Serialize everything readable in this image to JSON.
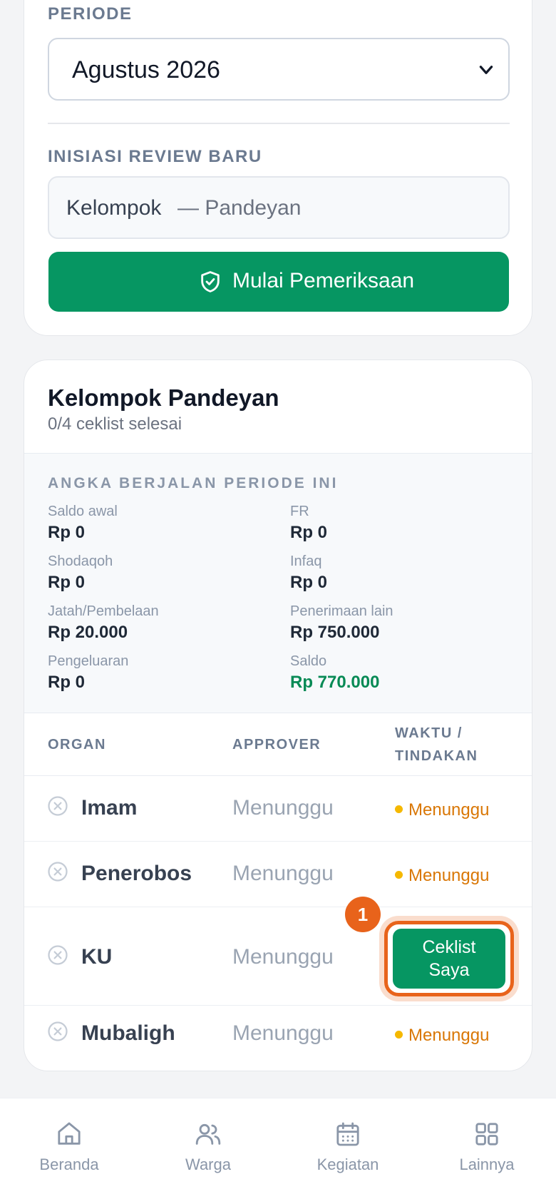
{
  "form": {
    "period_label": "PERIODE",
    "period_value": "Agustus 2026",
    "review_label": "INISIASI REVIEW BARU",
    "review_value": "Kelompok",
    "review_hint": "— Pandeyan",
    "start_button": "Mulai Pemeriksaan"
  },
  "group": {
    "title": "Kelompok Pandeyan",
    "subtitle": "0/4 ceklist selesai",
    "stats_heading": "ANGKA BERJALAN PERIODE INI",
    "stats": [
      {
        "label": "Saldo awal",
        "value": "Rp 0"
      },
      {
        "label": "FR",
        "value": "Rp 0"
      },
      {
        "label": "Shodaqoh",
        "value": "Rp 0"
      },
      {
        "label": "Infaq",
        "value": "Rp 0"
      },
      {
        "label": "Jatah/Pembelaan",
        "value": "Rp 20.000"
      },
      {
        "label": "Penerimaan lain",
        "value": "Rp 750.000"
      },
      {
        "label": "Pengeluaran",
        "value": "Rp 0"
      },
      {
        "label": "Saldo",
        "value": "Rp 770.000"
      }
    ],
    "table": {
      "headers": [
        "ORGAN",
        "APPROVER",
        "WAKTU /",
        "TINDAKAN"
      ],
      "rows": [
        {
          "organ": "Imam",
          "approver": "Menunggu",
          "status": "Menunggu"
        },
        {
          "organ": "Penerobos",
          "approver": "Menunggu",
          "status": "Menunggu"
        },
        {
          "organ": "KU",
          "approver": "Menunggu",
          "action_line1": "Ceklist",
          "action_line2": "Saya",
          "badge": "1"
        },
        {
          "organ": "Mubaligh",
          "approver": "Menunggu",
          "status": "Menunggu"
        }
      ]
    }
  },
  "nav": {
    "items": [
      {
        "label": "Beranda",
        "icon": "home-icon"
      },
      {
        "label": "Warga",
        "icon": "users-icon"
      },
      {
        "label": "Kegiatan",
        "icon": "calendar-icon"
      },
      {
        "label": "Lainnya",
        "icon": "grid-icon"
      }
    ]
  },
  "colors": {
    "primary": "#069662",
    "accent": "#e8631b",
    "pending": "#d97706",
    "positive": "#078a55"
  }
}
